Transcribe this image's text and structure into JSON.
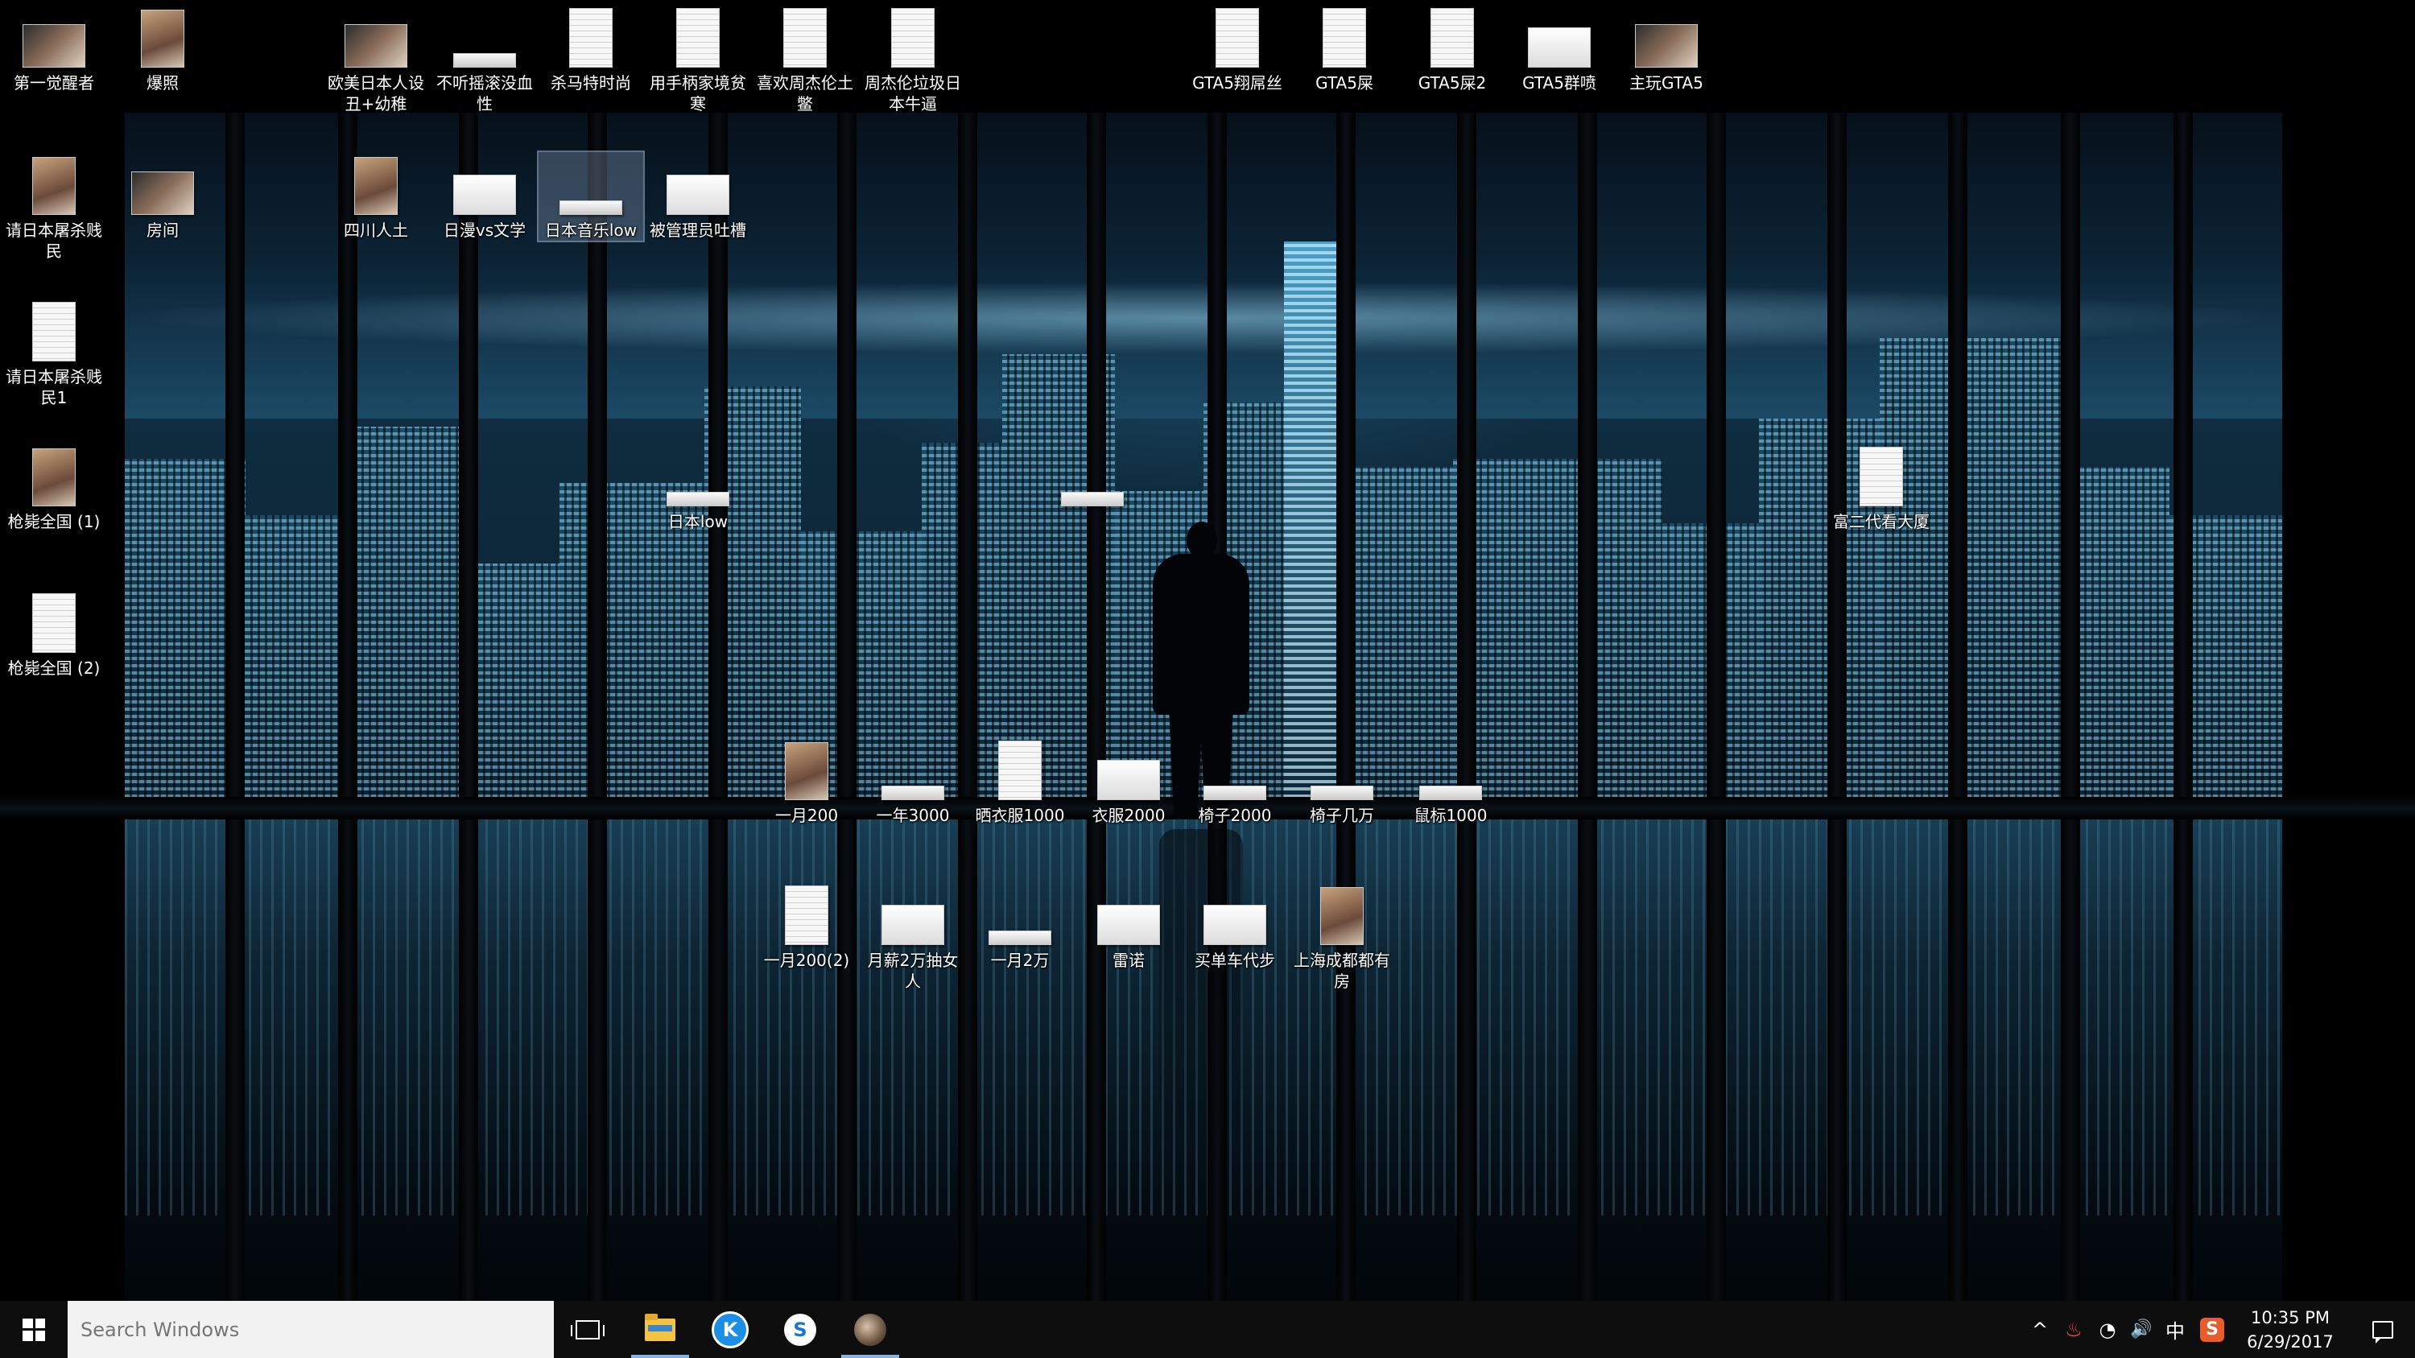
{
  "desktop": {
    "icons": [
      {
        "label": "第一觉醒者",
        "kind": "pic"
      },
      {
        "label": "爆照",
        "kind": "photo"
      },
      {
        "label": "欧美日本人设丑+幼稚",
        "kind": "pic"
      },
      {
        "label": "不听摇滚没血性",
        "kind": "thin"
      },
      {
        "label": "杀马特时尚",
        "kind": "doc"
      },
      {
        "label": "用手柄家境贫寒",
        "kind": "doc"
      },
      {
        "label": "喜欢周杰伦土鳖",
        "kind": "doc"
      },
      {
        "label": "周杰伦垃圾日本牛逼",
        "kind": "doc"
      },
      {
        "label": "GTA5翔屌丝",
        "kind": "doc"
      },
      {
        "label": "GTA5屎",
        "kind": "doc"
      },
      {
        "label": "GTA5屎2",
        "kind": "doc"
      },
      {
        "label": "GTA5群喷",
        "kind": "wide"
      },
      {
        "label": "主玩GTA5",
        "kind": "pic"
      },
      {
        "label": "请日本屠杀贱民",
        "kind": "photo"
      },
      {
        "label": "房间",
        "kind": "pic"
      },
      {
        "label": "四川人土",
        "kind": "photo"
      },
      {
        "label": "日漫vs文学",
        "kind": "wide"
      },
      {
        "label": "日本音乐low",
        "kind": "thin",
        "selected": true
      },
      {
        "label": "被管理员吐槽",
        "kind": "wide"
      },
      {
        "label": "请日本屠杀贱民1",
        "kind": "doc"
      },
      {
        "label": "日本low",
        "kind": "thin"
      },
      {
        "label": "",
        "kind": "thin"
      },
      {
        "label": "富二代看大厦",
        "kind": "doc"
      },
      {
        "label": "枪毙全国 (1)",
        "kind": "photo"
      },
      {
        "label": "枪毙全国 (2)",
        "kind": "doc"
      },
      {
        "label": "一月200",
        "kind": "photo"
      },
      {
        "label": "一年3000",
        "kind": "thin"
      },
      {
        "label": "晒衣服1000",
        "kind": "doc"
      },
      {
        "label": "衣服2000",
        "kind": "wide"
      },
      {
        "label": "椅子2000",
        "kind": "thin"
      },
      {
        "label": "椅子几万",
        "kind": "thin"
      },
      {
        "label": "鼠标1000",
        "kind": "thin"
      },
      {
        "label": "一月200(2)",
        "kind": "doc"
      },
      {
        "label": "月薪2万抽女人",
        "kind": "wide"
      },
      {
        "label": "一月2万",
        "kind": "thin"
      },
      {
        "label": "雷诺",
        "kind": "wide"
      },
      {
        "label": "买单车代步",
        "kind": "wide"
      },
      {
        "label": "上海成都都有房",
        "kind": "photo"
      }
    ]
  },
  "taskbar": {
    "start_icon": "windows-logo-icon",
    "search_placeholder": "Search Windows",
    "apps": [
      {
        "name": "task-view-icon"
      },
      {
        "name": "file-explorer-icon"
      },
      {
        "name": "kugou-icon",
        "glyph": "K",
        "color": "#1a8fe3"
      },
      {
        "name": "sogou-browser-icon",
        "glyph": "S",
        "color": "#1e73d6"
      },
      {
        "name": "avatar-app-icon"
      }
    ],
    "tray": {
      "chevron": "^",
      "battery_glyph": "♨",
      "wifi_glyph": "◔",
      "volume_glyph": "🔊",
      "ime": "中",
      "sogou_ime_glyph": "S"
    },
    "clock": {
      "time": "10:35 PM",
      "date": "6/29/2017"
    }
  },
  "colors": {
    "taskbar_bg": "#0e0e0e",
    "search_bg": "#f2f2f2",
    "accent": "#7fb6e6"
  }
}
